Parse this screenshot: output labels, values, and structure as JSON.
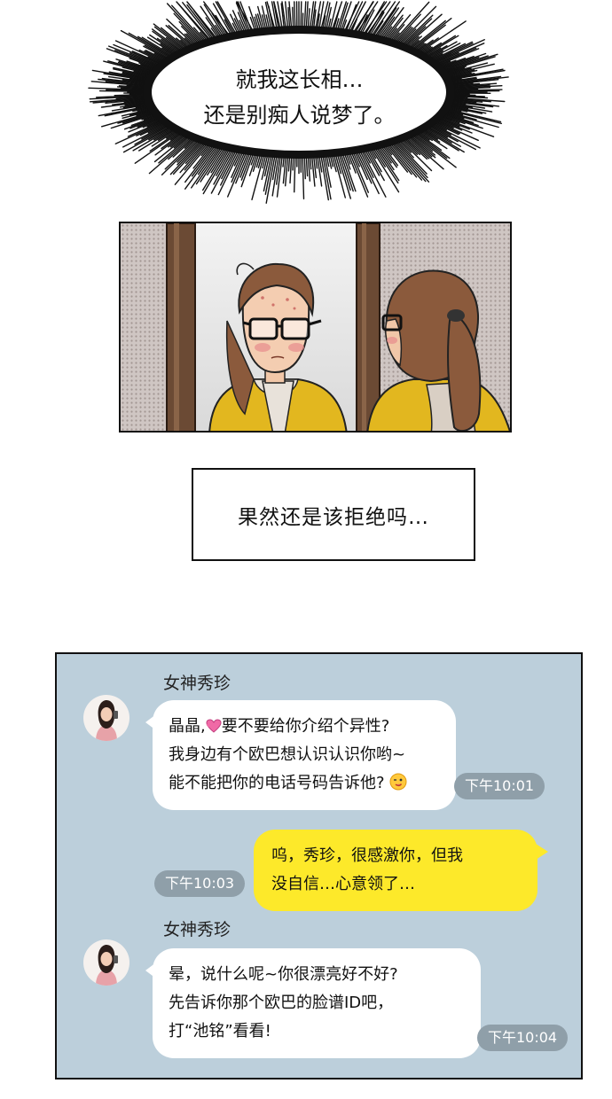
{
  "thought": {
    "lines": [
      "就我这长相…",
      "还是别痴人说梦了。"
    ]
  },
  "caption": {
    "text": "果然还是该拒绝吗…"
  },
  "chat": {
    "messages": [
      {
        "sender": "女神秀珍",
        "line1_before_icon": "晶晶,",
        "line1_after_icon": "要不要给你介绍个异性?",
        "line2": "我身边有个欧巴想认识认识你哟~",
        "line3": "能不能把你的电话号码告诉他?",
        "time": "下午10:01"
      },
      {
        "line1": "呜，秀珍，很感激你，但我",
        "line2": "没自信…心意领了…",
        "time": "下午10:03"
      },
      {
        "sender": "女神秀珍",
        "line1": "晕，说什么呢~你很漂亮好不好?",
        "line2": "先告诉你那个欧巴的脸谱ID吧，",
        "line3": "打“池铭”看看!",
        "time": "下午10:04"
      }
    ]
  },
  "colors": {
    "chat_background": "#bccfdb",
    "incoming_bubble": "#ffffff",
    "outgoing_bubble": "#fde92a",
    "timestamp_pill": "#8f9fa9",
    "shirt_yellow": "#e2b71f"
  },
  "icons": [
    "spiky-thought-bubble",
    "heart-icon",
    "winking-face-emoji",
    "avatar-icon"
  ]
}
